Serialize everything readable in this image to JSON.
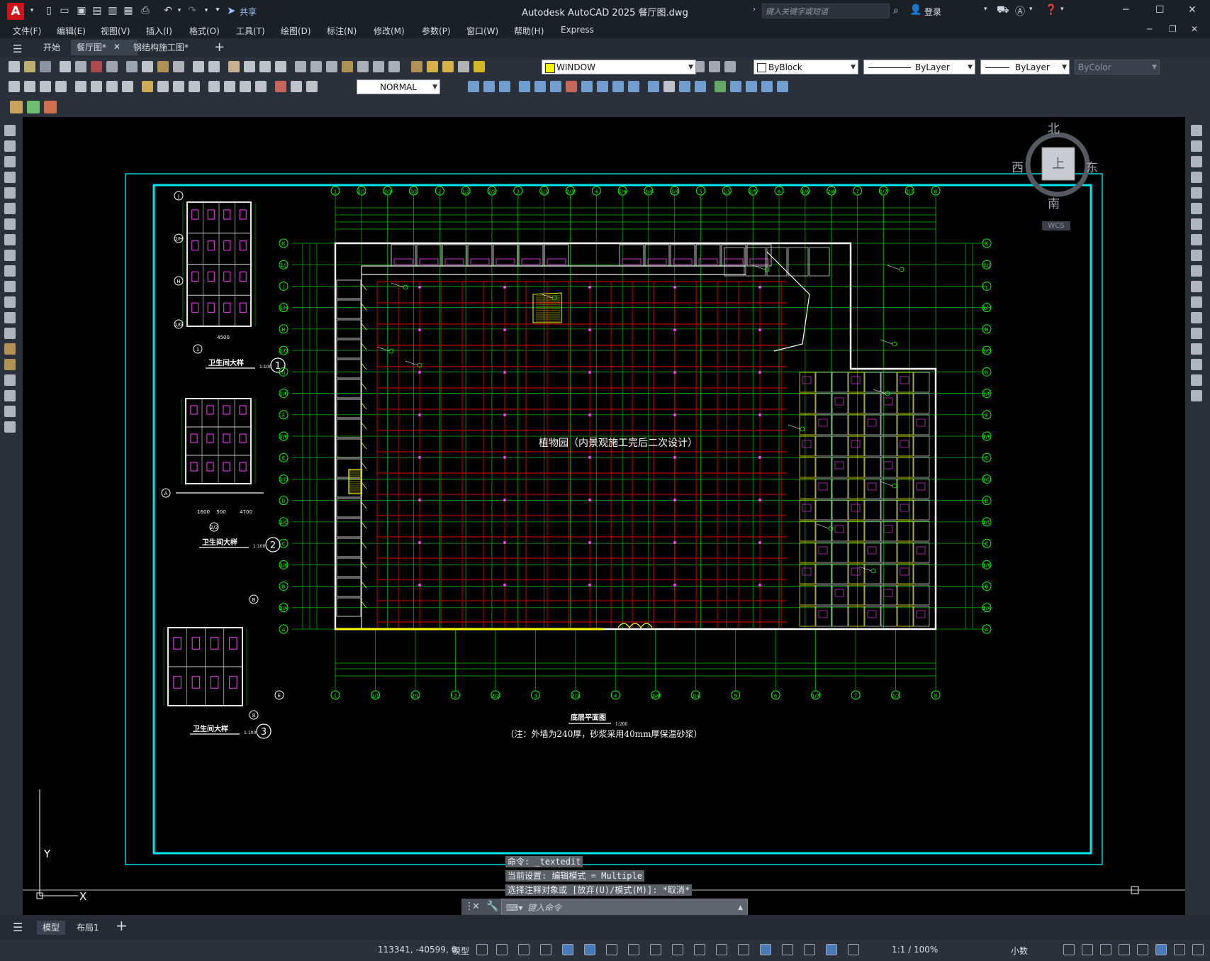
{
  "app": {
    "logo_letter": "A",
    "title": "Autodesk AutoCAD 2025    餐厅图.dwg",
    "share_label": "共享",
    "search_placeholder": "键入关键字或短语",
    "login_label": "登录"
  },
  "menu": [
    "文件(F)",
    "编辑(E)",
    "视图(V)",
    "插入(I)",
    "格式(O)",
    "工具(T)",
    "绘图(D)",
    "标注(N)",
    "修改(M)",
    "参数(P)",
    "窗口(W)",
    "帮助(H)",
    "Express"
  ],
  "tabs": [
    {
      "label": "开始"
    },
    {
      "label": "餐厅图*"
    },
    {
      "label": "钢结构施工图*"
    }
  ],
  "toolbar": {
    "layer_name": "WINDOW",
    "color": "ByBlock",
    "linetype": "ByLayer",
    "lineweight": "ByLayer",
    "plotstyle": "ByColor",
    "dimstyle": "NORMAL"
  },
  "viewcube": {
    "north": "北",
    "south": "南",
    "east": "东",
    "west": "西",
    "top": "上",
    "wcs": "WCS"
  },
  "drawing": {
    "main_label": "植物园（内景观施工完后二次设计）",
    "plan_title": "底层平面图",
    "plan_scale": "1:200",
    "plan_note": "（注：外墙为240厚，砂浆采用40mm厚保温砂浆）",
    "detail1_title": "卫生间大样",
    "detail1_scale": "1:100",
    "detail1_num": "1",
    "detail2_title": "卫生间大样",
    "detail2_scale": "1:100",
    "detail2_num": "2",
    "detail3_title": "卫生间大样",
    "detail3_scale": "1:100",
    "detail3_num": "3",
    "grid_top": [
      "1",
      "1/1",
      "2/1",
      "3/1",
      "2",
      "1/2",
      "2/2",
      "3",
      "1/3",
      "2/3",
      "4",
      "1/4",
      "2/4",
      "3/4",
      "5",
      "1/5",
      "2/5",
      "6",
      "1/6",
      "2/6",
      "7",
      "1/7",
      "2/7",
      "8"
    ],
    "grid_bottom": [
      "1",
      "1/1",
      "2/1",
      "2",
      "2/2",
      "3",
      "2/3",
      "4",
      "2/4",
      "3/4",
      "5",
      "6",
      "1/7",
      "7",
      "2/7",
      "8"
    ],
    "grid_rows": [
      "K",
      "1/J",
      "J",
      "1/H",
      "H",
      "1/G",
      "G",
      "1/F",
      "F",
      "1/E",
      "E",
      "1/D",
      "D",
      "1/C",
      "C",
      "1/B",
      "B",
      "1/A",
      "A"
    ],
    "detail1_rows": [
      "J",
      "1/H",
      "H",
      "1/G"
    ],
    "detail1_col": "1",
    "detail1_dim": "4500",
    "detail2_row": "A",
    "detail2_col": "2/2",
    "detail2_dims": [
      "1600",
      "500",
      "4700"
    ],
    "detail3_rows": [
      "B",
      "E"
    ],
    "detail3_col": "8"
  },
  "command": {
    "line1": "命令: _textedit",
    "line2": "当前设置: 编辑模式 = Multiple",
    "line3": "选择注释对象或 [放弃(U)/模式(M)]: *取消*",
    "placeholder": "键入命令"
  },
  "layout_tabs": [
    {
      "label": "模型"
    },
    {
      "label": "布局1"
    }
  ],
  "status": {
    "coords": "113341, -40599, 0",
    "model": "模型",
    "scale": "1:1 / 100%",
    "units": "小数"
  },
  "ucs": {
    "y": "Y",
    "x": "X"
  }
}
